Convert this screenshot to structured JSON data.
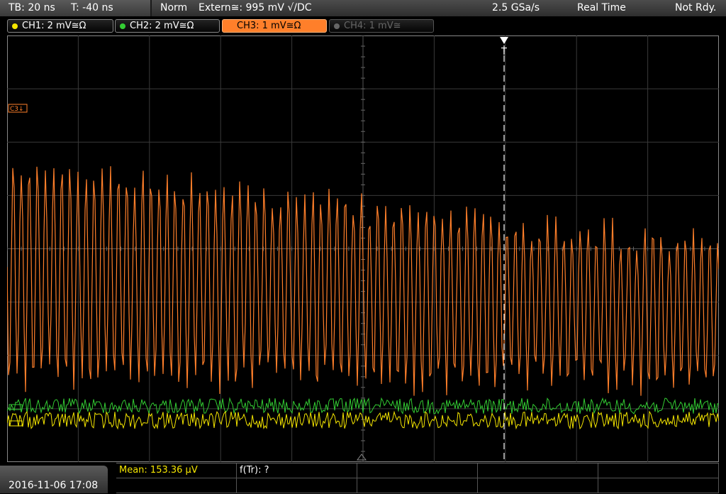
{
  "status": {
    "timebase": "TB: 20 ns",
    "trigger_offset": "T: -40 ns",
    "mode": "Norm",
    "trigger": "Extern≅: 995 mV √/DC",
    "sample_rate": "2.5 GSa/s",
    "acq_mode": "Real Time",
    "state": "Not Rdy."
  },
  "channels": [
    {
      "label": "CH1: 2 mV≅Ω",
      "color": "#f5e600",
      "active": false
    },
    {
      "label": "CH2: 2 mV≅Ω",
      "color": "#33cc33",
      "active": false
    },
    {
      "label": "CH3: 1 mV≅Ω",
      "color": "#ff7f2a",
      "active": true
    },
    {
      "label": "CH4: 1 mV≅",
      "color": "#666666",
      "active": false
    }
  ],
  "markers": {
    "c3": "C3↓",
    "trigger": "T"
  },
  "measurements": {
    "mean": "Mean: 153.36 µV",
    "freq": "f(Tr): ?"
  },
  "datetime": "2016-11-06 17:08",
  "colors": {
    "ch1": "#f5e600",
    "ch2": "#33cc33",
    "ch3": "#ff7f2a",
    "grid": "#3a3a3a"
  }
}
